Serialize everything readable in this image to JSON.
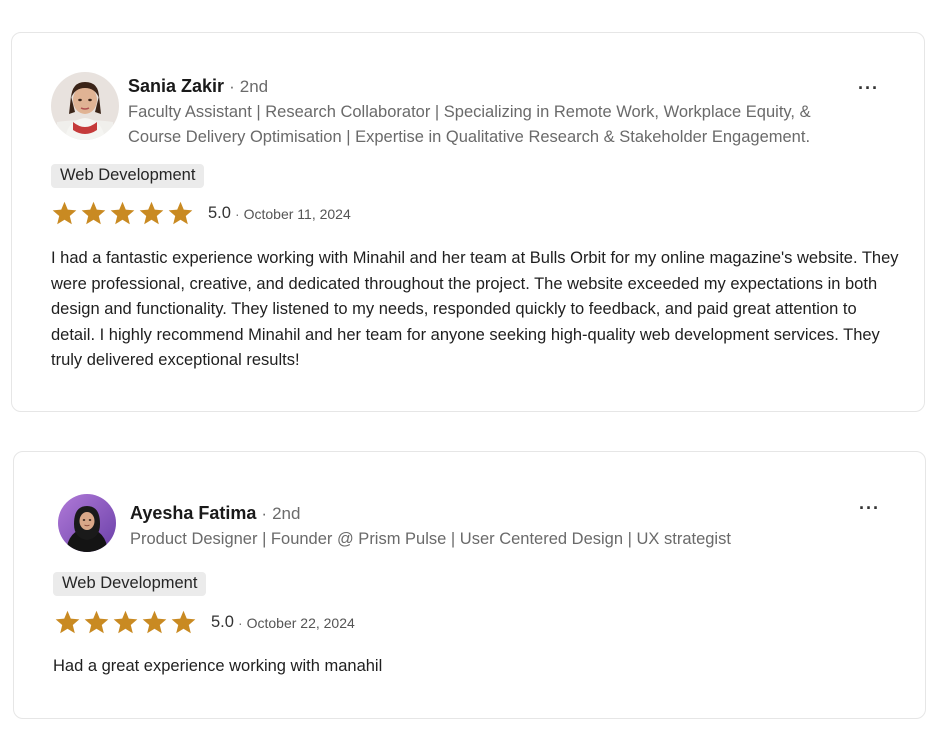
{
  "colors": {
    "star": "#c98a22",
    "tag_bg": "#ebebeb",
    "border": "#e6e6e6"
  },
  "reviews": [
    {
      "reviewer_name": "Sania Zakir",
      "separator": "·",
      "degree": "2nd",
      "headline": "Faculty Assistant | Research Collaborator | Specializing in Remote Work, Workplace Equity, & Course Delivery Optimisation | Expertise in Qualitative Research & Stakeholder Engagement.",
      "more_label": "···",
      "tag": "Web Development",
      "rating": 5,
      "score": "5.0",
      "date_separator": "·",
      "date": "October 11, 2024",
      "text": "I had a fantastic experience working with Minahil and her team at Bulls Orbit for my online magazine's website. They were professional, creative, and dedicated throughout the project. The website exceeded my expectations in both design and functionality. They listened to my needs, responded quickly to feedback, and paid great attention to detail. I highly recommend Minahil and her team for anyone seeking high-quality web development services. They truly delivered exceptional results!",
      "star_icon": "star-icon",
      "avatar_icon": "avatar"
    },
    {
      "reviewer_name": "Ayesha Fatima",
      "separator": "·",
      "degree": "2nd",
      "headline": "Product Designer | Founder @ Prism Pulse | User Centered Design | UX strategist",
      "more_label": "···",
      "tag": "Web Development",
      "rating": 5,
      "score": "5.0",
      "date_separator": "·",
      "date": "October 22, 2024",
      "text": "Had a great experience working with manahil",
      "star_icon": "star-icon",
      "avatar_icon": "avatar"
    }
  ]
}
